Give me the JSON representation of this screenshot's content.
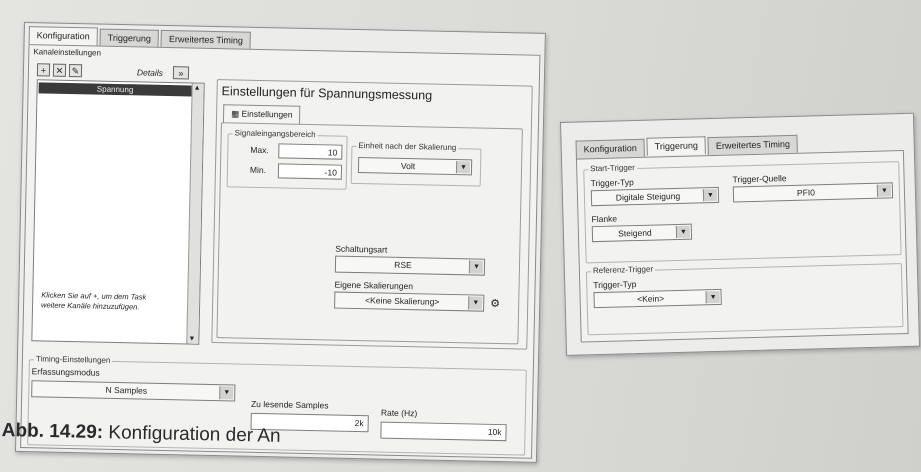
{
  "left": {
    "tabs": [
      "Konfiguration",
      "Triggerung",
      "Erweitertes Timing"
    ],
    "channel_settings_label": "Kanaleinstellungen",
    "details_label": "Details",
    "details_button": "»",
    "channel_list": [
      "Spannung"
    ],
    "hint": "Klicken Sie auf +, um dem Task weitere Kanäle hinzuzufügen.",
    "settings_title": "Einstellungen für Spannungsmessung",
    "settings_tab": "Einstellungen",
    "range_group": "Signaleingangsbereich",
    "max_label": "Max.",
    "max_value": "10",
    "min_label": "Min.",
    "min_value": "-10",
    "unit_group": "Einheit nach der Skalierung",
    "unit_value": "Volt",
    "wiring_label": "Schaltungsart",
    "wiring_value": "RSE",
    "scaling_label": "Eigene Skalierungen",
    "scaling_value": "<Keine Skalierung>",
    "timing_group": "Timing-Einstellungen",
    "mode_label": "Erfassungsmodus",
    "mode_value": "N Samples",
    "samples_label": "Zu lesende Samples",
    "samples_value": "2k",
    "rate_label": "Rate (Hz)",
    "rate_value": "10k"
  },
  "right": {
    "tabs": [
      "Konfiguration",
      "Triggerung",
      "Erweitertes Timing"
    ],
    "start_group": "Start-Trigger",
    "start_type_label": "Trigger-Typ",
    "start_type_value": "Digitale Steigung",
    "source_label": "Trigger-Quelle",
    "source_value": "PFI0",
    "edge_label": "Flanke",
    "edge_value": "Steigend",
    "ref_group": "Referenz-Trigger",
    "ref_type_label": "Trigger-Typ",
    "ref_type_value": "<Kein>"
  },
  "caption": {
    "number": "Abb. 14.29:",
    "text": "Konfiguration der An"
  },
  "colors": {
    "selected_row": "#3a3a3a",
    "panel": "#ececea"
  }
}
